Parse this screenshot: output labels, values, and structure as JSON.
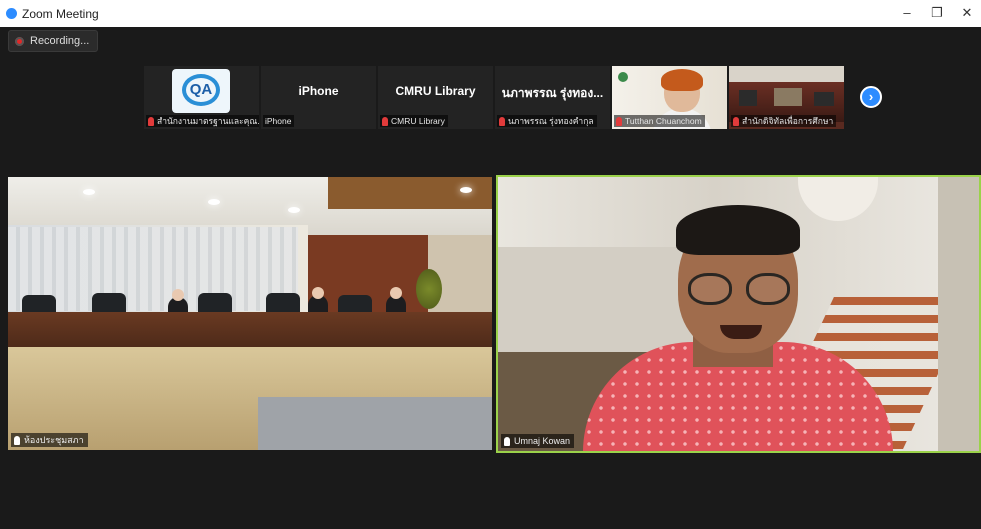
{
  "window": {
    "title": "Zoom Meeting",
    "minimize": "–",
    "maximize": "❐",
    "close": "✕"
  },
  "recording": {
    "label": "Recording..."
  },
  "thumbnails": [
    {
      "big_text": "",
      "label": "สำนักงานมาตรฐานและคุณ...",
      "kind": "qa-logo",
      "logo_text": "QA"
    },
    {
      "big_text": "iPhone",
      "label": "iPhone",
      "kind": "text"
    },
    {
      "big_text": "CMRU Library",
      "label": "CMRU Library",
      "kind": "text"
    },
    {
      "big_text": "นภาพรรณ รุ่งทอง...",
      "label": "นภาพรรณ รุ่งทองคำกุล",
      "kind": "text"
    },
    {
      "big_text": "",
      "label": "Tutthan Chuanchom",
      "kind": "face"
    },
    {
      "big_text": "",
      "label": "สำนักดิจิทัลเพื่อการศึกษา",
      "kind": "room"
    }
  ],
  "next_button": {
    "label": "›"
  },
  "tiles": {
    "left": {
      "name": "ห้องประชุมสภา"
    },
    "right": {
      "name": "Umnaj Kowan"
    }
  },
  "colors": {
    "active_speaker_border": "#9bd24a",
    "accent": "#2d8cff",
    "muted_mic": "#e23b3b"
  }
}
